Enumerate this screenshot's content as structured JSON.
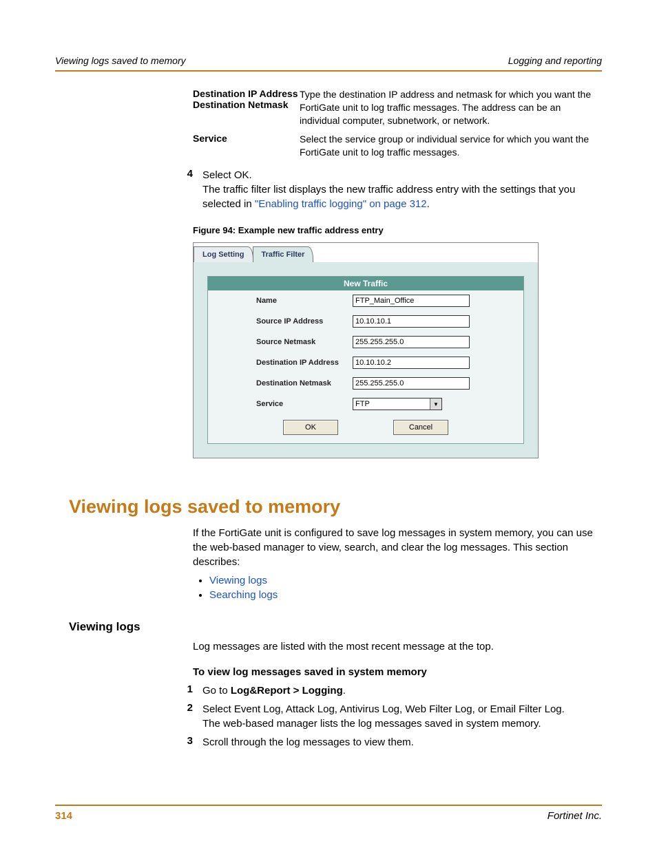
{
  "header": {
    "left": "Viewing logs saved to memory",
    "right": "Logging and reporting"
  },
  "definitions": [
    {
      "labels": [
        "Destination IP Address",
        "Destination Netmask"
      ],
      "desc": "Type the destination IP address and netmask for which you want the FortiGate unit to log traffic messages. The address can be an individual computer, subnetwork, or network."
    },
    {
      "labels": [
        "Service"
      ],
      "desc": "Select the service group or individual service for which you want the FortiGate unit to log traffic messages."
    }
  ],
  "step4": {
    "num": "4",
    "line1": "Select OK.",
    "line2_pre": "The traffic filter list displays the new traffic address entry with the settings that you selected in ",
    "line2_link": "\"Enabling traffic logging\" on page 312",
    "line2_post": "."
  },
  "figure": {
    "caption": "Figure 94: Example new traffic address entry",
    "tabs": [
      "Log Setting",
      "Traffic Filter"
    ],
    "panel_title": "New Traffic",
    "fields": {
      "name": {
        "label": "Name",
        "value": "FTP_Main_Office"
      },
      "src_ip": {
        "label": "Source IP Address",
        "value": "10.10.10.1"
      },
      "src_mask": {
        "label": "Source Netmask",
        "value": "255.255.255.0"
      },
      "dst_ip": {
        "label": "Destination IP Address",
        "value": "10.10.10.2"
      },
      "dst_mask": {
        "label": "Destination Netmask",
        "value": "255.255.255.0"
      },
      "service": {
        "label": "Service",
        "value": "FTP"
      }
    },
    "buttons": {
      "ok": "OK",
      "cancel": "Cancel"
    }
  },
  "section": {
    "title": "Viewing logs saved to memory",
    "intro": "If the FortiGate unit is configured to save log messages in system memory, you can use the web-based manager to view, search, and clear the log messages. This section describes:",
    "bullets": [
      "Viewing logs",
      "Searching logs"
    ]
  },
  "subsection": {
    "title": "Viewing logs",
    "para": "Log messages are listed with the most recent message at the top.",
    "task_title": "To view log messages saved in system memory",
    "steps": [
      {
        "num": "1",
        "pre": "Go to ",
        "bold": "Log&Report > Logging",
        "post": "."
      },
      {
        "num": "2",
        "text": "Select Event Log, Attack Log, Antivirus Log, Web Filter Log, or Email Filter Log.",
        "text2": "The web-based manager lists the log messages saved in system memory."
      },
      {
        "num": "3",
        "text": "Scroll through the log messages to view them."
      }
    ]
  },
  "footer": {
    "page": "314",
    "brand": "Fortinet Inc."
  }
}
